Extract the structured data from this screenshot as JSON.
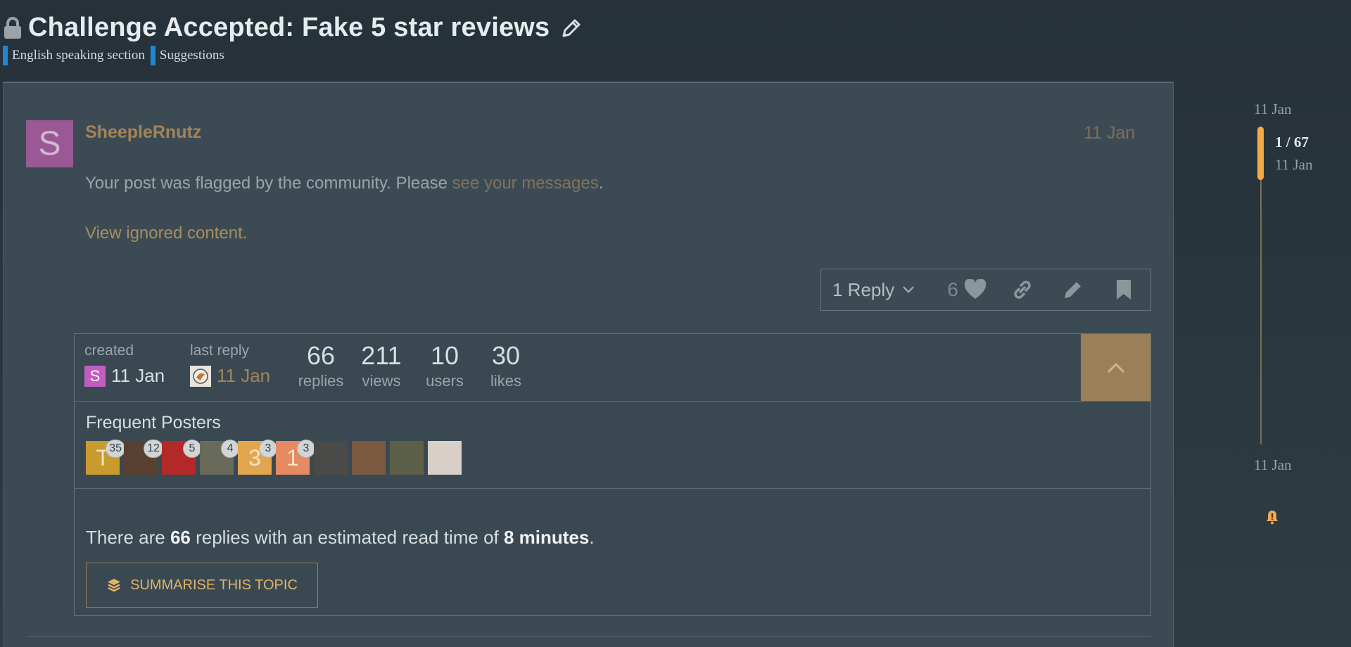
{
  "topic": {
    "title": "Challenge Accepted: Fake 5 star reviews",
    "categories": [
      "English speaking section",
      "Suggestions"
    ],
    "category_color": "#1e88d5"
  },
  "post": {
    "avatar_letter": "S",
    "avatar_color": "#9a5894",
    "username": "SheepleRnutz",
    "date": "11 Jan",
    "flag_text": "Your post was flagged by the community. Please ",
    "flag_link": "see your messages",
    "flag_end": ".",
    "ignored_link": "View ignored content.",
    "actions": {
      "reply_label": "1 Reply",
      "like_count": "6"
    }
  },
  "topic_map": {
    "created_label": "created",
    "created_avatar_letter": "S",
    "created_date": "11 Jan",
    "last_reply_label": "last reply",
    "last_reply_date": "11 Jan",
    "stats": [
      {
        "value": "66",
        "label": "replies"
      },
      {
        "value": "211",
        "label": "views"
      },
      {
        "value": "10",
        "label": "users"
      },
      {
        "value": "30",
        "label": "likes"
      }
    ],
    "frequent_posters_title": "Frequent Posters",
    "posters": [
      {
        "letter": "T",
        "color": "#c99a2e",
        "count": "35"
      },
      {
        "letter": "",
        "color": "#5a4030",
        "count": "12"
      },
      {
        "letter": "",
        "color": "#b32828",
        "count": "5"
      },
      {
        "letter": "",
        "color": "#6a6a5a",
        "count": "4"
      },
      {
        "letter": "3",
        "color": "#e2a64e",
        "count": "3"
      },
      {
        "letter": "1",
        "color": "#e58a62",
        "count": "3"
      },
      {
        "letter": "",
        "color": "#4a4a48",
        "count": ""
      },
      {
        "letter": "",
        "color": "#7a5a40",
        "count": ""
      },
      {
        "letter": "",
        "color": "#5c6048",
        "count": ""
      },
      {
        "letter": "",
        "color": "#d8d0c8",
        "count": ""
      }
    ],
    "summary_prefix": "There are ",
    "summary_replies": "66",
    "summary_middle": " replies with an estimated read time of ",
    "summary_time": "8 minutes",
    "summary_end": ".",
    "summarise_label": "SUMMARISE THIS TOPIC"
  },
  "timeline": {
    "top_date": "11 Jan",
    "position": "1 / 67",
    "position_date": "11 Jan",
    "bottom_date": "11 Jan"
  },
  "colors": {
    "accent": "#9b7f58",
    "timeline_handle": "#f2a94a"
  }
}
